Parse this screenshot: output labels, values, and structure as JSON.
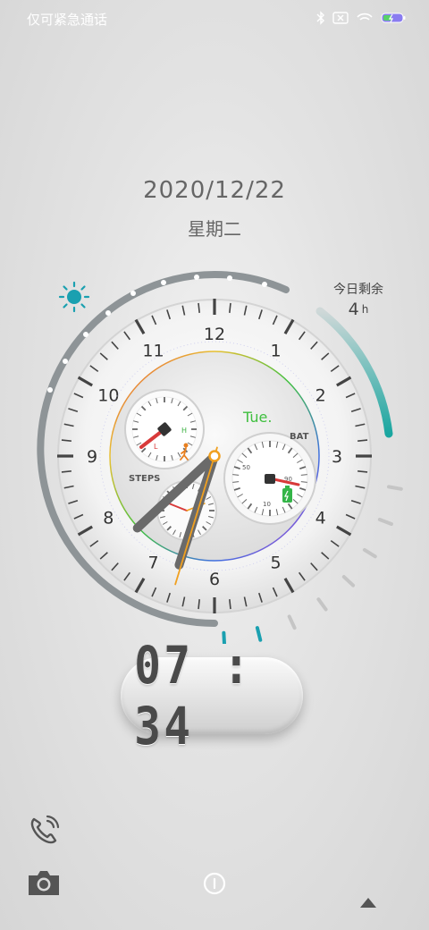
{
  "status_bar": {
    "carrier_text": "仅可紧急通话",
    "icons": [
      "bluetooth-icon",
      "no-sim-icon",
      "wifi-icon",
      "battery-charging-icon"
    ]
  },
  "date": "2020/12/22",
  "weekday": "星期二",
  "remaining": {
    "label": "今日剩余",
    "value": "4",
    "unit": "h"
  },
  "clock": {
    "numerals": [
      "12",
      "1",
      "2",
      "3",
      "4",
      "5",
      "6",
      "7",
      "8",
      "9",
      "10",
      "11"
    ],
    "day_abbrev": "Tue.",
    "steps_label": "STEPS",
    "bat_label": "BAT",
    "sub_l": "L",
    "sub_h": "H",
    "bat_50": "50",
    "bat_10": "10",
    "bat_90": "90",
    "hour": 7,
    "minute": 34,
    "second": 17,
    "weather_icon": "sun-icon",
    "accent_color": "#2aa0b0",
    "second_hand_color": "#f0a020"
  },
  "digital_time": "07 : 34",
  "bottom": {
    "left_icons": [
      "phone-icon",
      "camera-icon"
    ],
    "center_icon": "info-icon",
    "right_icon": "arrow-up-icon"
  }
}
